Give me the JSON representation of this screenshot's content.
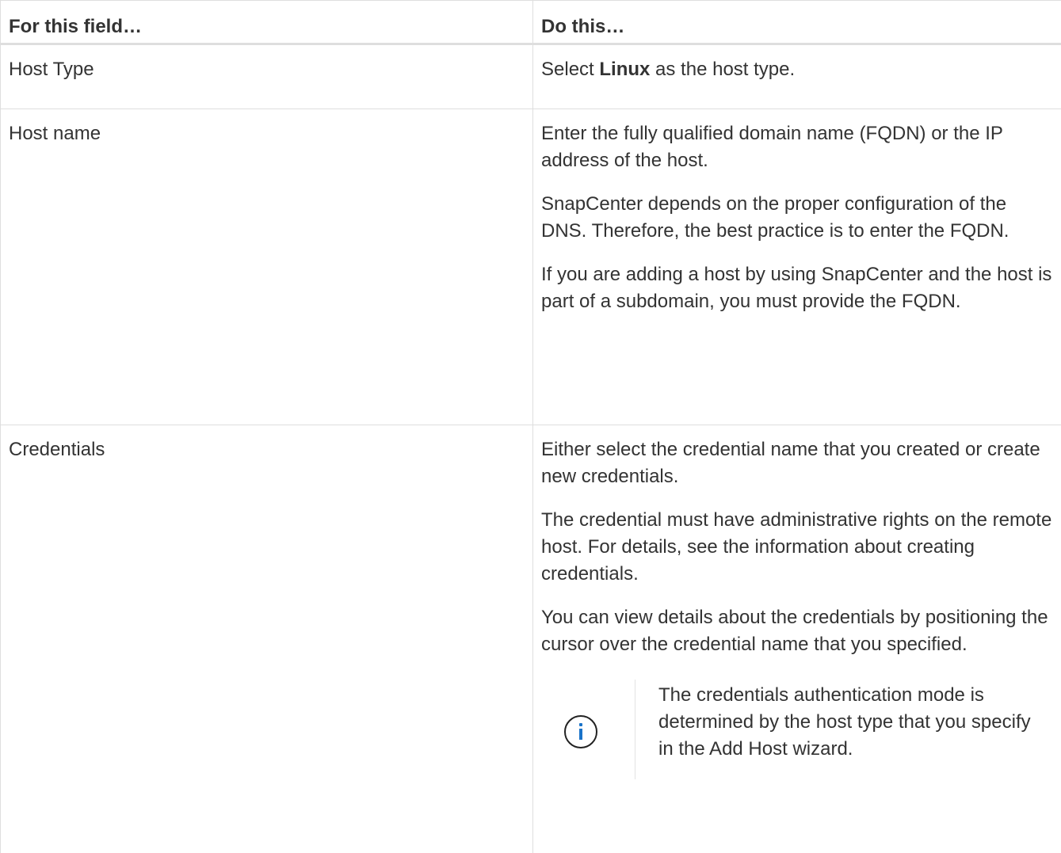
{
  "table": {
    "header": {
      "col1": "For this field…",
      "col2": "Do this…"
    },
    "rows": [
      {
        "field": "Host Type",
        "action": {
          "prefix": "Select ",
          "bold": "Linux",
          "suffix": " as the host type."
        }
      },
      {
        "field": "Host name",
        "paragraphs": [
          "Enter the fully qualified domain name (FQDN) or the IP address of the host.",
          "SnapCenter depends on the proper configuration of the DNS. Therefore, the best practice is to enter the FQDN.",
          "If you are adding a host by using SnapCenter and the host is part of a subdomain, you must provide the FQDN."
        ]
      },
      {
        "field": "Credentials",
        "paragraphs": [
          "Either select the credential name that you created or create new credentials.",
          "The credential must have administrative rights on the remote host. For details, see the information about creating credentials.",
          "You can view details about the credentials by positioning the cursor over the credential name that you specified."
        ],
        "note": {
          "icon": "info-icon",
          "text": "The credentials authentication mode is determined by the host type that you specify in the Add Host wizard."
        }
      }
    ]
  },
  "colors": {
    "text": "#333333",
    "border": "#dedede",
    "info_accent": "#1a73c9"
  }
}
